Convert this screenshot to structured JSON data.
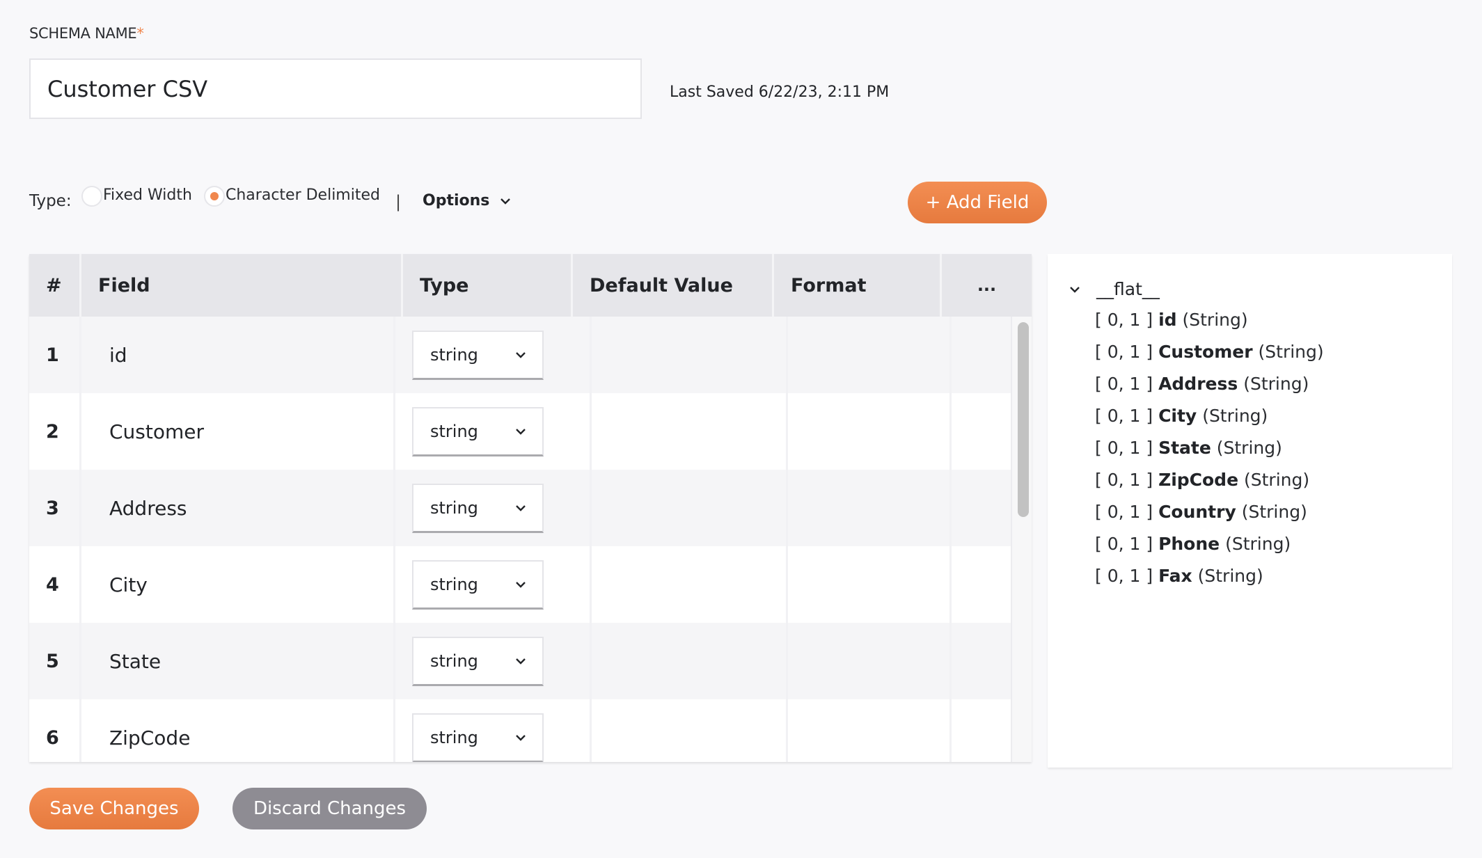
{
  "schema": {
    "label": "SCHEMA NAME",
    "required_mark": "*",
    "name_value": "Customer CSV",
    "last_saved": "Last Saved 6/22/23, 2:11 PM"
  },
  "type_row": {
    "label": "Type:",
    "options": [
      {
        "label": "Fixed Width",
        "selected": false
      },
      {
        "label": "Character Delimited",
        "selected": true
      }
    ],
    "separator": "|",
    "options_menu_label": "Options",
    "add_field_label": "+ Add Field"
  },
  "colors": {
    "accent": "#f0874d",
    "secondary_button": "#8e8c93",
    "table_header": "#e6e6ea"
  },
  "table": {
    "columns": [
      "#",
      "Field",
      "Type",
      "Default Value",
      "Format",
      "..."
    ],
    "rows": [
      {
        "num": "1",
        "field": "id",
        "type": "string",
        "default": "",
        "format": ""
      },
      {
        "num": "2",
        "field": "Customer",
        "type": "string",
        "default": "",
        "format": ""
      },
      {
        "num": "3",
        "field": "Address",
        "type": "string",
        "default": "",
        "format": ""
      },
      {
        "num": "4",
        "field": "City",
        "type": "string",
        "default": "",
        "format": ""
      },
      {
        "num": "5",
        "field": "State",
        "type": "string",
        "default": "",
        "format": ""
      },
      {
        "num": "6",
        "field": "ZipCode",
        "type": "string",
        "default": "",
        "format": ""
      }
    ]
  },
  "tree": {
    "root": "__flat__",
    "items": [
      {
        "card": "[ 0, 1 ]",
        "name": "id",
        "type": "(String)"
      },
      {
        "card": "[ 0, 1 ]",
        "name": "Customer",
        "type": "(String)"
      },
      {
        "card": "[ 0, 1 ]",
        "name": "Address",
        "type": "(String)"
      },
      {
        "card": "[ 0, 1 ]",
        "name": "City",
        "type": "(String)"
      },
      {
        "card": "[ 0, 1 ]",
        "name": "State",
        "type": "(String)"
      },
      {
        "card": "[ 0, 1 ]",
        "name": "ZipCode",
        "type": "(String)"
      },
      {
        "card": "[ 0, 1 ]",
        "name": "Country",
        "type": "(String)"
      },
      {
        "card": "[ 0, 1 ]",
        "name": "Phone",
        "type": "(String)"
      },
      {
        "card": "[ 0, 1 ]",
        "name": "Fax",
        "type": "(String)"
      }
    ]
  },
  "footer": {
    "save_label": "Save Changes",
    "discard_label": "Discard Changes"
  }
}
